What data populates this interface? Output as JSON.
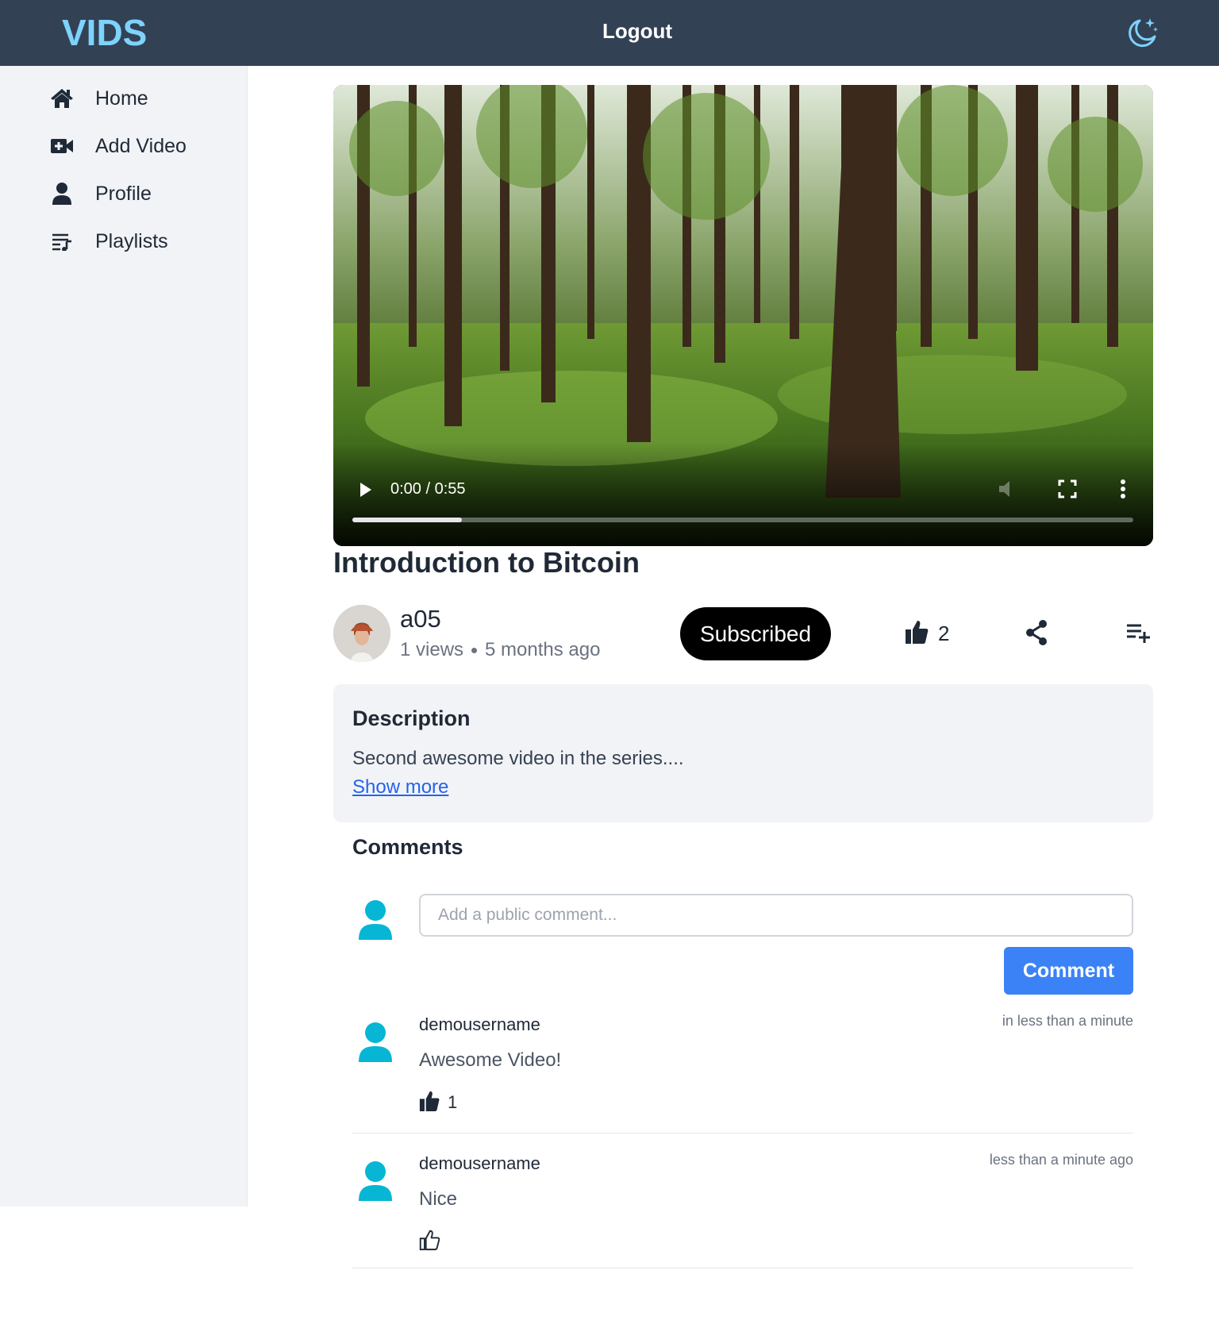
{
  "header": {
    "logo": "VIDS",
    "logout_label": "Logout",
    "theme_icon": "moon-stars-icon"
  },
  "sidebar": {
    "items": [
      {
        "label": "Home",
        "icon": "home-icon"
      },
      {
        "label": "Add Video",
        "icon": "video-plus-icon"
      },
      {
        "label": "Profile",
        "icon": "user-icon"
      },
      {
        "label": "Playlists",
        "icon": "playlist-icon"
      }
    ]
  },
  "player": {
    "time_label": "0:00 / 0:55",
    "progress_fraction": 0.14
  },
  "video": {
    "title": "Introduction to Bitcoin",
    "channel": "a05",
    "views": "1 views",
    "age": "5 months ago",
    "subscribe_label": "Subscribed",
    "likes": "2"
  },
  "description": {
    "heading": "Description",
    "text": "Second awesome video in the series....",
    "show_more": "Show more"
  },
  "comments": {
    "heading": "Comments",
    "input_placeholder": "Add a public comment...",
    "submit_label": "Comment",
    "items": [
      {
        "user": "demousername",
        "time": "in less than a minute",
        "text": "Awesome Video!",
        "likes": "1",
        "liked": true
      },
      {
        "user": "demousername",
        "time": "less than a minute ago",
        "text": "Nice",
        "likes": "",
        "liked": false
      }
    ]
  },
  "colors": {
    "header_bg": "#334155",
    "logo": "#7dd3fc",
    "accent_blue": "#3b82f6",
    "user_icon": "#06b6d4"
  }
}
